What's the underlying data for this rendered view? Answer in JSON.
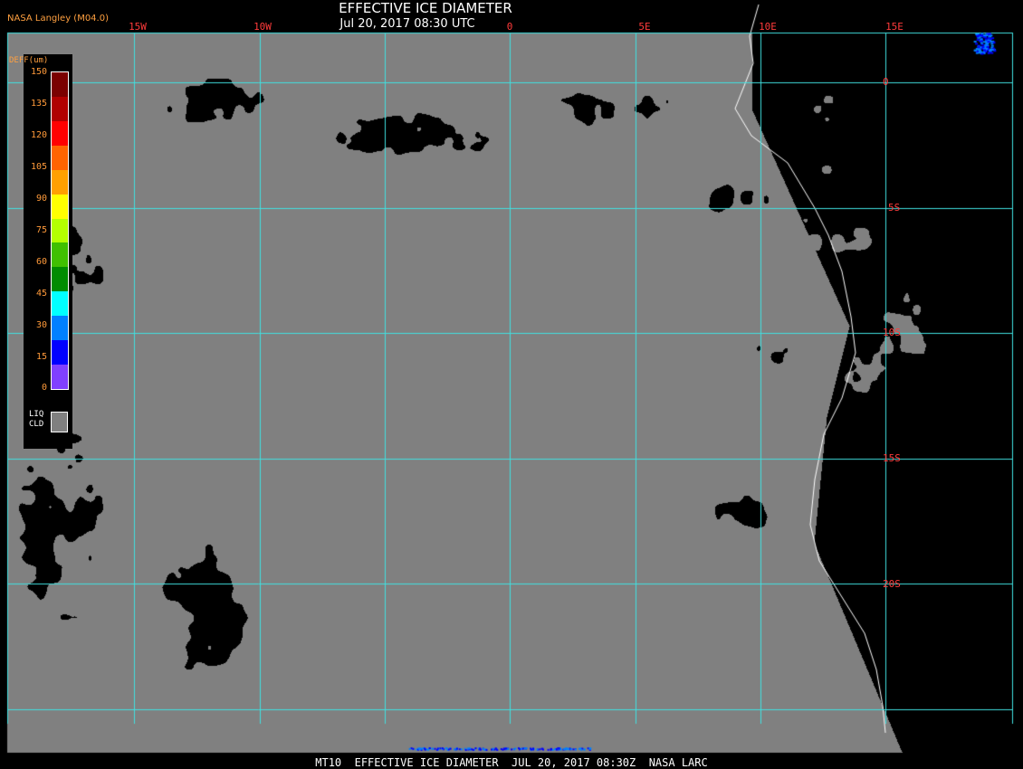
{
  "header": {
    "title": "EFFECTIVE ICE DIAMETER",
    "subtitle": "Jul 20, 2017 08:30 UTC",
    "source": "NASA Langley (M04.0)"
  },
  "grid": {
    "longitudes": [
      "15W",
      "10W",
      "0",
      "5E",
      "10E",
      "15E"
    ],
    "latitudes": [
      "0",
      "5S",
      "10S",
      "15S",
      "20S"
    ],
    "color": "#40e0e0"
  },
  "legend": {
    "title": "DEFF(um)",
    "ticks": [
      "150",
      "135",
      "120",
      "105",
      "90",
      "75",
      "60",
      "45",
      "30",
      "15",
      "0"
    ],
    "colors": [
      "#7a0000",
      "#b00000",
      "#ff0000",
      "#ff6400",
      "#ffa000",
      "#ffff00",
      "#b4ff00",
      "#40c000",
      "#008c00",
      "#00ffff",
      "#0080ff",
      "#0000ff",
      "#8040ff"
    ],
    "liquid_label_1": "LIQ",
    "liquid_label_2": "CLD",
    "liquid_color": "#808080"
  },
  "colors": {
    "cloud": "#808080",
    "clear": "#000000",
    "coastline": "#ffffff"
  },
  "footer": "MT10  EFFECTIVE ICE DIAMETER  JUL 20, 2017 08:30Z  NASA LARC"
}
